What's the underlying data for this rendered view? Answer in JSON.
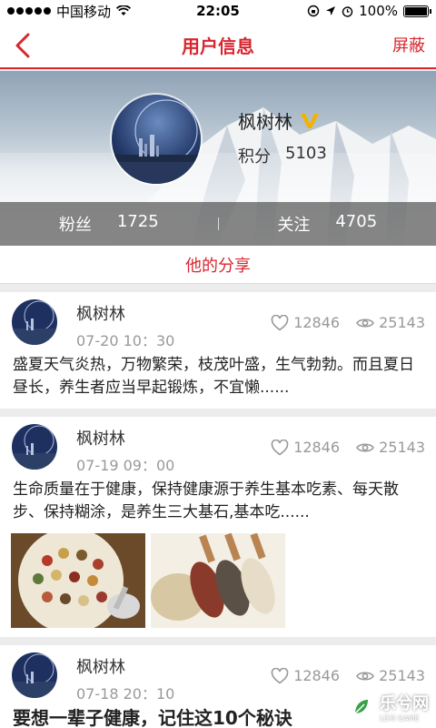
{
  "status_bar": {
    "carrier": "中国移动",
    "time": "22:05",
    "battery_percent": "100%"
  },
  "nav": {
    "title": "用户信息",
    "right_action": "屏蔽",
    "back_icon": "chevron-left-icon"
  },
  "profile": {
    "name": "枫树林",
    "verified_icon": "vip-v-icon",
    "points_label": "积分",
    "points_value": "5103",
    "fans_label": "粉丝",
    "fans_value": "1725",
    "following_label": "关注",
    "following_value": "4705"
  },
  "section_tab": "他的分享",
  "colors": {
    "accent": "#d8262f",
    "background": "#ececec"
  },
  "posts": [
    {
      "author": "枫树林",
      "time": "07-20  10：30",
      "likes": "12846",
      "views": "25143",
      "text": "盛夏天气炎热，万物繁荣，枝茂叶盛，生气勃勃。而且夏日昼长，养生者应当早起锻炼，不宜懒......"
    },
    {
      "author": "枫树林",
      "time": "07-19  09：00",
      "likes": "12846",
      "views": "25143",
      "text": "生命质量在于健康，保持健康源于养生基本吃素、每天散步、保持糊涂，是养生三大基石,基本吃......"
    },
    {
      "author": "枫树林",
      "time": "07-18  20：10",
      "likes": "12846",
      "views": "25143",
      "text": "要想一辈子健康，记住这10个秘诀"
    }
  ],
  "watermark": {
    "text": "乐兮网",
    "sub": "LEXI GAME"
  }
}
